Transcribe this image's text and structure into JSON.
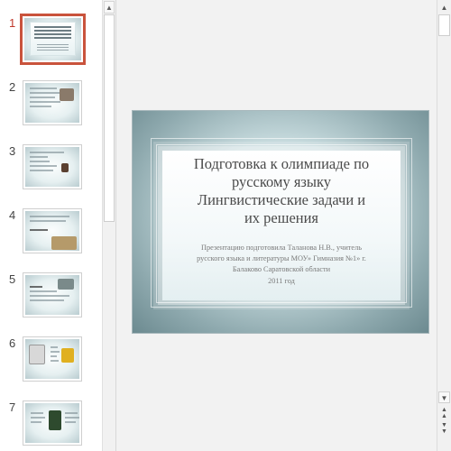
{
  "thumbnails": [
    {
      "number": "1",
      "selected": true
    },
    {
      "number": "2",
      "selected": false
    },
    {
      "number": "3",
      "selected": false
    },
    {
      "number": "4",
      "selected": false
    },
    {
      "number": "5",
      "selected": false
    },
    {
      "number": "6",
      "selected": false
    },
    {
      "number": "7",
      "selected": false
    }
  ],
  "slide": {
    "title_lines": [
      "Подготовка к олимпиаде по",
      "русскому языку",
      "Лингвистические задачи и",
      "их решения"
    ],
    "subtitle_lines": [
      "Презентацию подготовила Таланова Н.В., учитель",
      "русского языка и литературы МОУ» Гимназия №1» г.",
      "Балаково Саратовской области"
    ],
    "year": "2011 год"
  },
  "icons": {
    "scroll_up": "scroll-up-arrow-icon",
    "scroll_down": "scroll-down-arrow-icon",
    "prev_slide": "previous-slide-icon",
    "next_slide": "next-slide-icon"
  },
  "colors": {
    "selection_border": "#c9533c",
    "selected_number": "#c0392b"
  }
}
